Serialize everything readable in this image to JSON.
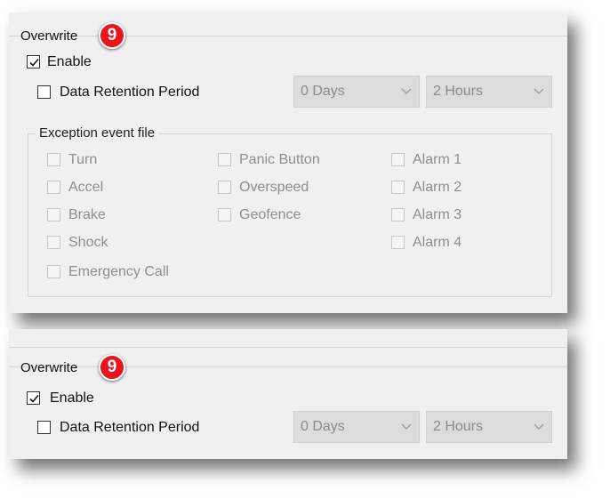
{
  "sections": [
    {
      "title": "Overwrite",
      "badge": "9",
      "enable_label": "Enable",
      "enable_checked": true,
      "retention_label": "Data Retention Period",
      "retention_checked": false,
      "days_value": "0 Days",
      "hours_value": "2 Hours",
      "exception": {
        "legend": "Exception event file",
        "col1": [
          "Turn",
          "Accel",
          "Brake",
          "Shock",
          "Emergency Call"
        ],
        "col2": [
          "Panic Button",
          "Overspeed",
          "Geofence"
        ],
        "col3": [
          "Alarm 1",
          "Alarm 2",
          "Alarm 3",
          "Alarm 4"
        ]
      }
    },
    {
      "title": "Overwrite",
      "badge": "9",
      "enable_label": "Enable",
      "enable_checked": true,
      "retention_label": "Data Retention Period",
      "retention_checked": false,
      "days_value": "0 Days",
      "hours_value": "2 Hours"
    }
  ],
  "icons": {
    "checkmark": "check-icon",
    "dropdown": "chevron-down-icon"
  },
  "colors": {
    "badge": "#e8141e",
    "panel": "#f0f0f0",
    "disabled_text": "#8e8e8e",
    "dropdown_bg": "#dcdcdc"
  }
}
